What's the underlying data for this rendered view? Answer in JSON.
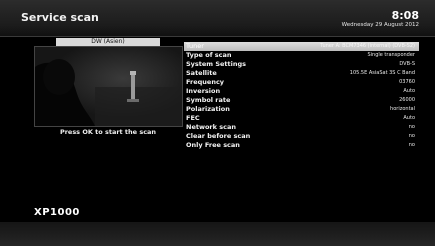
{
  "header": {
    "title": "Service scan",
    "time": "8:08",
    "date": "Wednesday 29 August 2012"
  },
  "preview": {
    "channel": "DW (Asien)"
  },
  "hint": "Press OK to start the scan",
  "settings": [
    {
      "label": "Tuner",
      "value": "Tuner A: BCM7346 (internal) (DVB-S2)"
    },
    {
      "label": "Type of scan",
      "value": "Single transponder"
    },
    {
      "label": "System Settings",
      "value": "DVB-S"
    },
    {
      "label": "Satellite",
      "value": "105.5E AsiaSat 3S C Band"
    },
    {
      "label": "Frequency",
      "value": "03760"
    },
    {
      "label": "Inversion",
      "value": "Auto"
    },
    {
      "label": "Symbol rate",
      "value": "26000"
    },
    {
      "label": "Polarization",
      "value": "horizontal"
    },
    {
      "label": "FEC",
      "value": "Auto"
    },
    {
      "label": "Network scan",
      "value": "no"
    },
    {
      "label": "Clear before scan",
      "value": "no"
    },
    {
      "label": "Only Free scan",
      "value": "no"
    }
  ],
  "selected_index": 0,
  "brand": "XP1000"
}
